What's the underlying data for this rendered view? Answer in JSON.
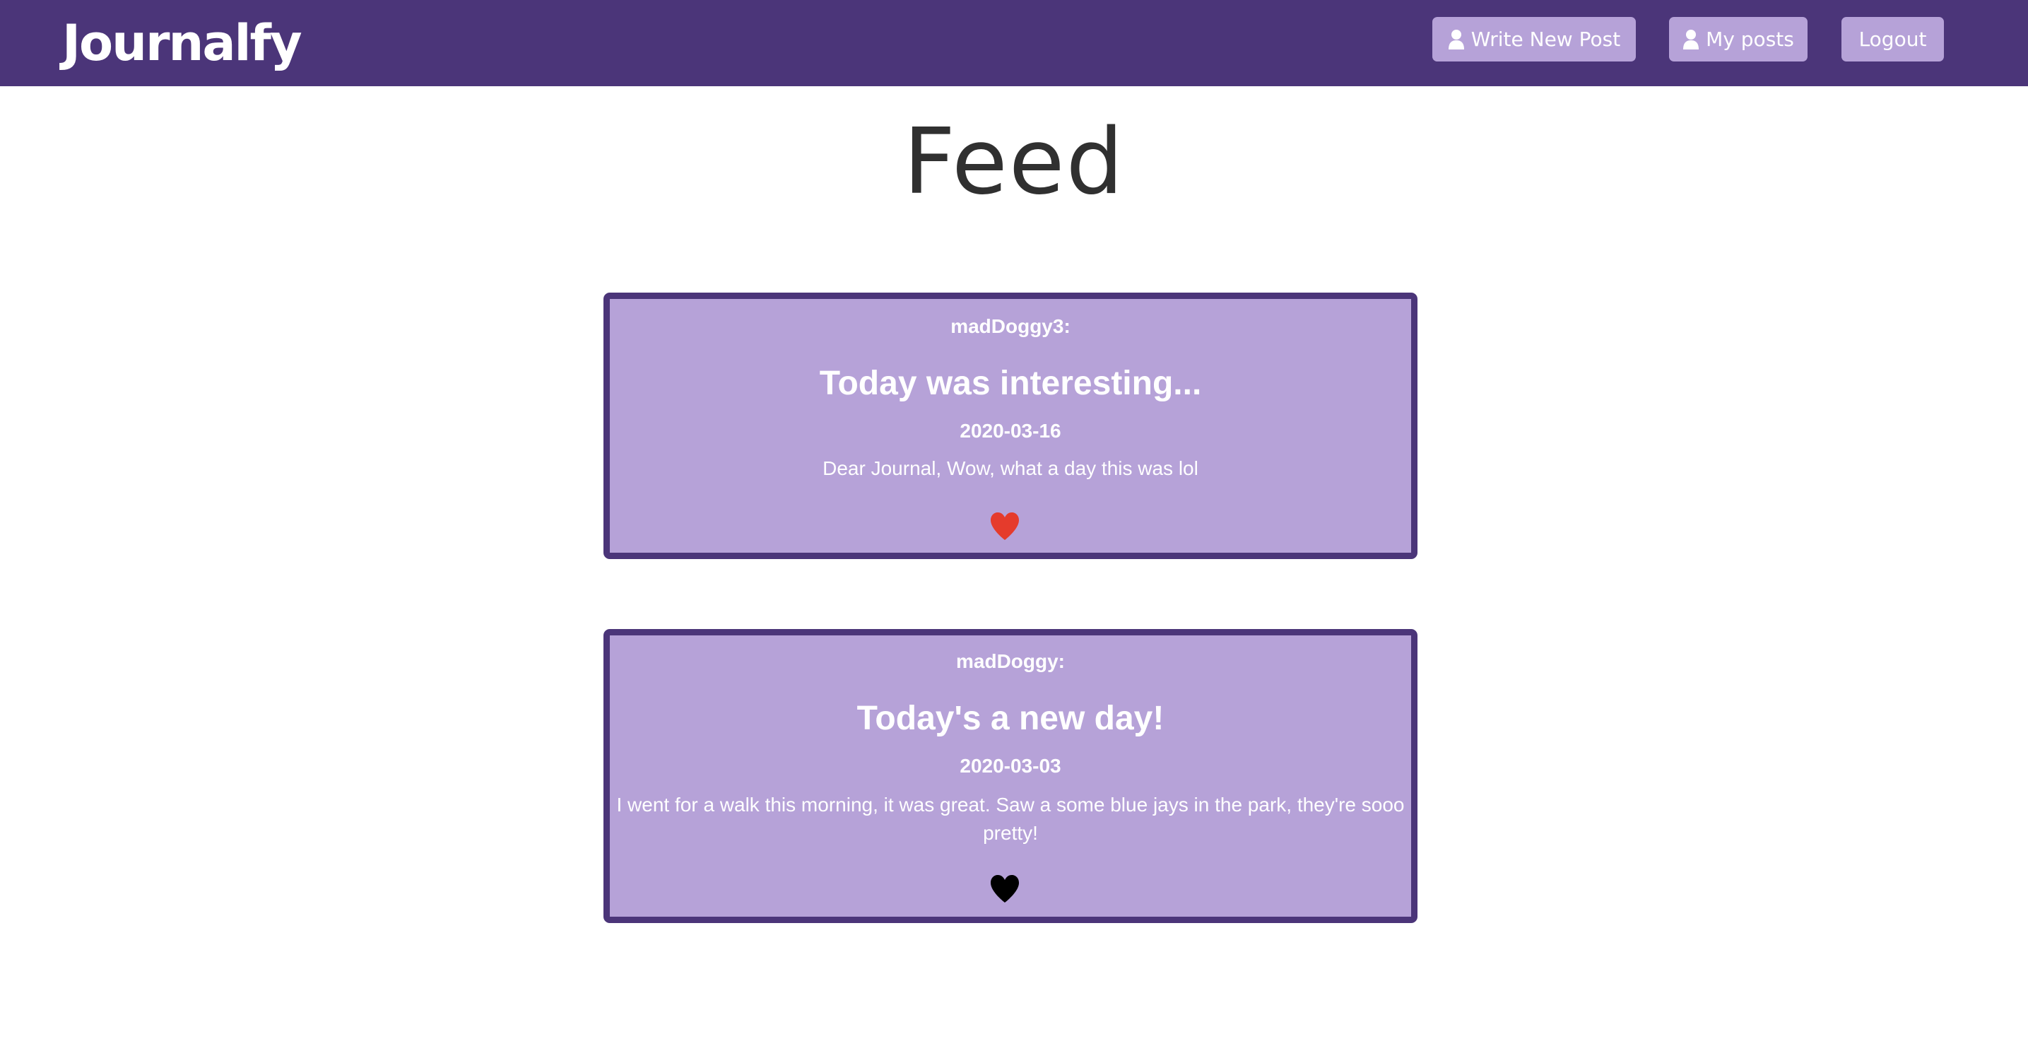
{
  "navbar": {
    "brand": "Journalfy",
    "buttons": {
      "write_new_post": "Write New Post",
      "my_posts": "My posts",
      "logout": "Logout"
    },
    "icons": {
      "write_new_post": "user-icon",
      "my_posts": "user-icon"
    }
  },
  "page": {
    "title": "Feed"
  },
  "colors": {
    "primary": "#4b3579",
    "card_background": "#b6a2d8",
    "liked_heart": "#e53b2c",
    "unliked_heart": "#000000"
  },
  "posts": [
    {
      "author": "madDoggy3:",
      "title": "Today was interesting...",
      "date": "2020-03-16",
      "body": "Dear Journal, Wow, what a day this was lol",
      "liked": true,
      "heart_icon": "heart-icon"
    },
    {
      "author": "madDoggy:",
      "title": "Today's a new day!",
      "date": "2020-03-03",
      "body": "I went for a walk this morning, it was great. Saw a some blue jays in the park, they're sooo pretty!",
      "liked": false,
      "heart_icon": "heart-icon"
    }
  ]
}
